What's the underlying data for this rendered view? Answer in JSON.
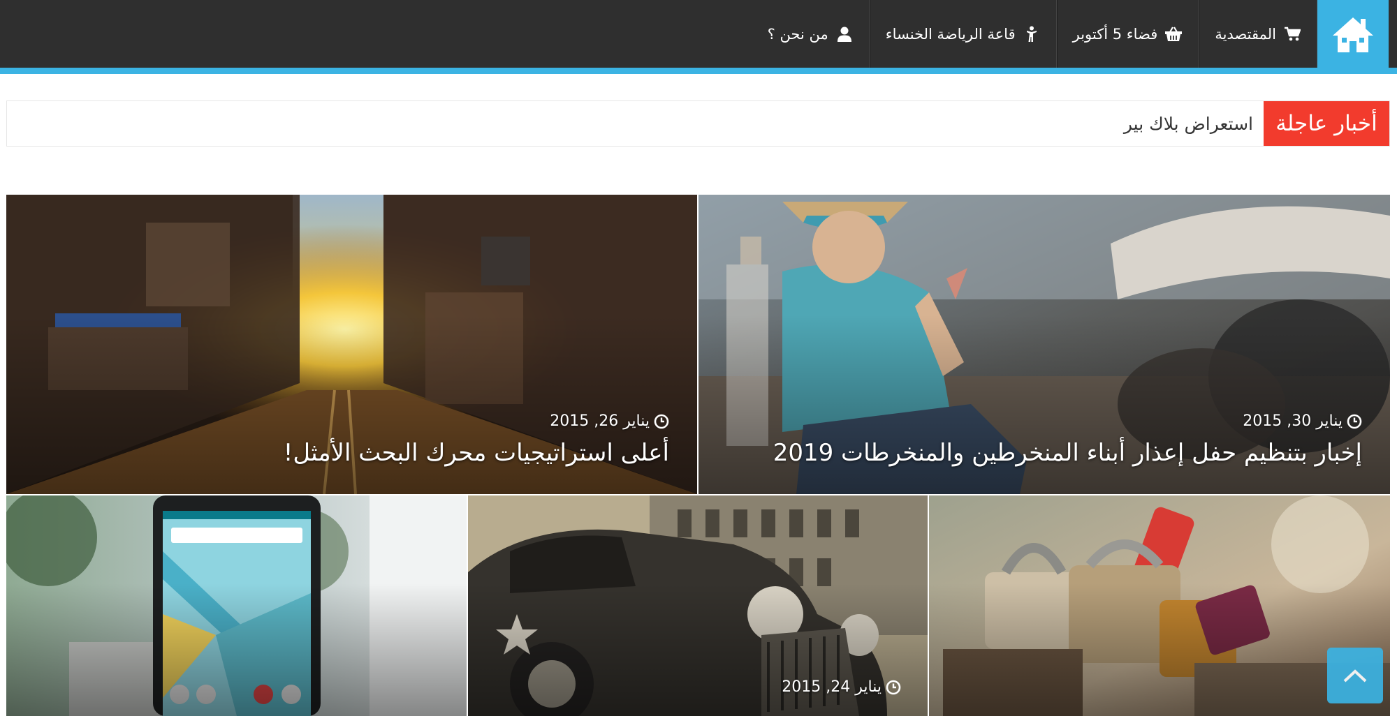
{
  "nav": {
    "items": [
      {
        "label": "المقتصدية",
        "icon": "shopping-cart-icon"
      },
      {
        "label": "فضاء 5 أكتوبر",
        "icon": "basket-icon"
      },
      {
        "label": "قاعة الرياضة الخنساء",
        "icon": "person-icon"
      },
      {
        "label": "من نحن ؟",
        "icon": "user-icon"
      }
    ],
    "home_icon": "home-icon",
    "colors": {
      "bar": "#2f2f2f",
      "accent": "#3bb3e3"
    }
  },
  "breaking": {
    "label": "أخبار عاجلة",
    "ticker": "استعراض بلاك بير",
    "color": "#f23b2d"
  },
  "featured": [
    {
      "date": "يناير 30, 2015",
      "title": "إخبار بتنظيم حفل إعذار أبناء المنخرطين والمنخرطات 2019"
    },
    {
      "date": "يناير 26, 2015",
      "title": "أعلى استراتيجيات محرك البحث الأمثل!"
    },
    {
      "date": "",
      "title": ""
    },
    {
      "date": "يناير 24, 2015",
      "title": ""
    },
    {
      "date": "",
      "title": ""
    }
  ],
  "scroll_top_icon": "chevron-up-icon"
}
